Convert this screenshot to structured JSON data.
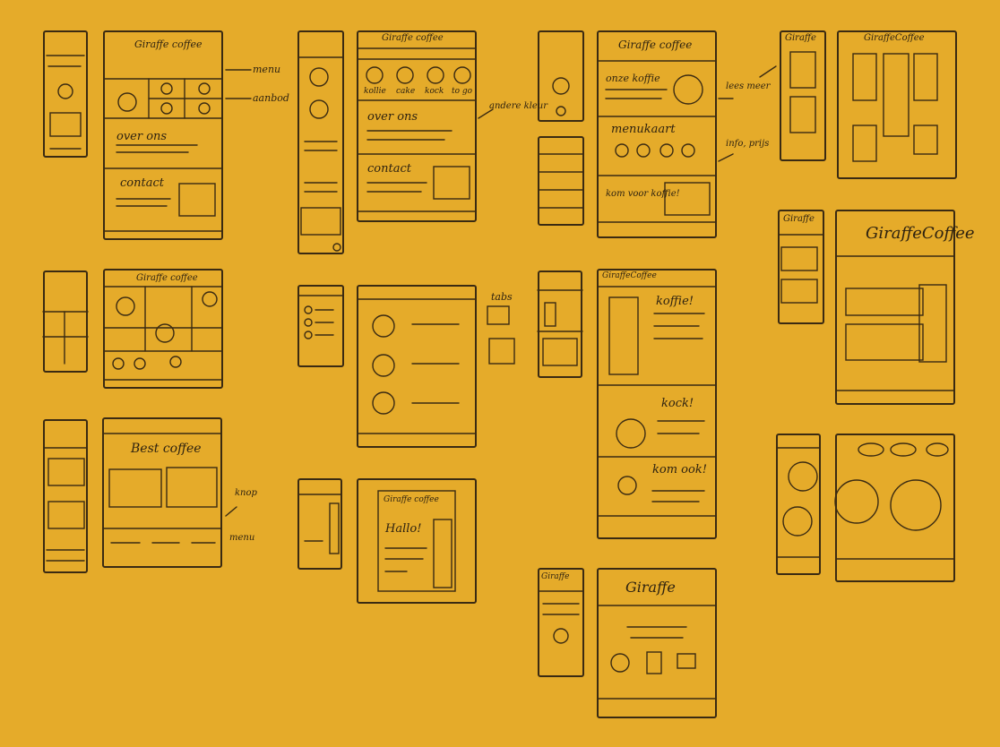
{
  "colors": {
    "background": "#e5ab2a",
    "ink": "#3a2a12"
  },
  "labels": {
    "menu": "menu",
    "aanbod": "aanbod",
    "giraffe_coffee": "Giraffe coffee",
    "over_ons": "over ons",
    "contact": "contact",
    "kollie": "kollie",
    "cake": "cake",
    "kock": "kock",
    "to_go": "to go",
    "andere_kleur": "andere kleur",
    "onze_koffie": "onze koffie",
    "menukaart": "menukaart",
    "lees_meer": "lees meer",
    "info_prijs": "info, prijs",
    "kom_voor_koffie": "kom voor koffie!",
    "tabs": "tabs",
    "best_coffee": "Best coffee",
    "knop": "knop",
    "menu2": "menu",
    "hallo": "Hallo!",
    "koffie_excl": "koffie!",
    "kock_excl": "kock!",
    "kom_ook": "kom ook!",
    "giraffe": "Giraffe",
    "giraffecoffee": "GiraffeCoffee",
    "giraffe_short": "Giraffe"
  },
  "frames": [
    {
      "name": "mobile-home-1"
    },
    {
      "name": "desktop-home-1"
    },
    {
      "name": "mobile-home-2"
    },
    {
      "name": "desktop-home-2"
    },
    {
      "name": "mobile-small-3"
    },
    {
      "name": "mobile-small-4"
    },
    {
      "name": "desktop-home-3"
    },
    {
      "name": "mobile-home-5"
    },
    {
      "name": "desktop-home-5"
    },
    {
      "name": "mobile-grid"
    },
    {
      "name": "desktop-grid"
    },
    {
      "name": "mobile-tabs"
    },
    {
      "name": "desktop-tabs"
    },
    {
      "name": "mobile-giraffe-a"
    },
    {
      "name": "desktop-giraffe-a"
    },
    {
      "name": "mobile-giraffe-b"
    },
    {
      "name": "desktop-giraffe-b"
    },
    {
      "name": "mobile-best"
    },
    {
      "name": "desktop-best"
    },
    {
      "name": "mobile-hallo"
    },
    {
      "name": "desktop-hallo"
    },
    {
      "name": "mobile-giraffe-c"
    },
    {
      "name": "desktop-giraffe-c"
    },
    {
      "name": "mobile-circle"
    },
    {
      "name": "desktop-circle"
    },
    {
      "name": "mobile-giraffe-d"
    },
    {
      "name": "desktop-giraffe-d"
    }
  ]
}
